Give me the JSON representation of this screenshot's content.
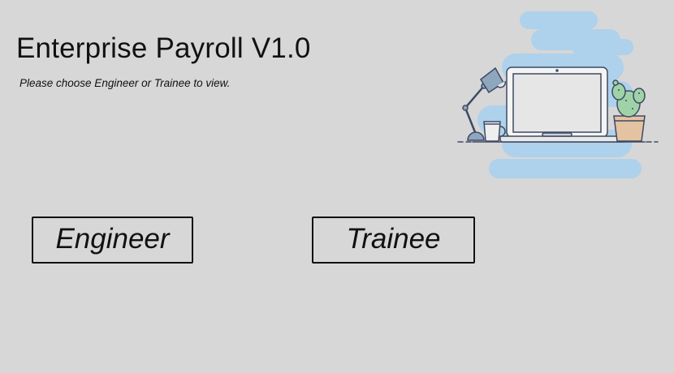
{
  "header": {
    "title": "Enterprise Payroll V1.0",
    "instruction": "Please choose Engineer or Trainee to view."
  },
  "buttons": {
    "engineer_label": "Engineer",
    "trainee_label": "Trainee"
  },
  "illustration": {
    "subject": "desk with laptop, lamp, mug and cactus",
    "colors": {
      "cloud": "#aed1ec",
      "outline": "#3e4a63",
      "screen": "#e8e8e8",
      "pot": "#e3c3a1",
      "cactus": "#9fd3a7"
    }
  },
  "theme": {
    "background": "#d7d7d7",
    "text": "#111111",
    "border": "#111111"
  }
}
